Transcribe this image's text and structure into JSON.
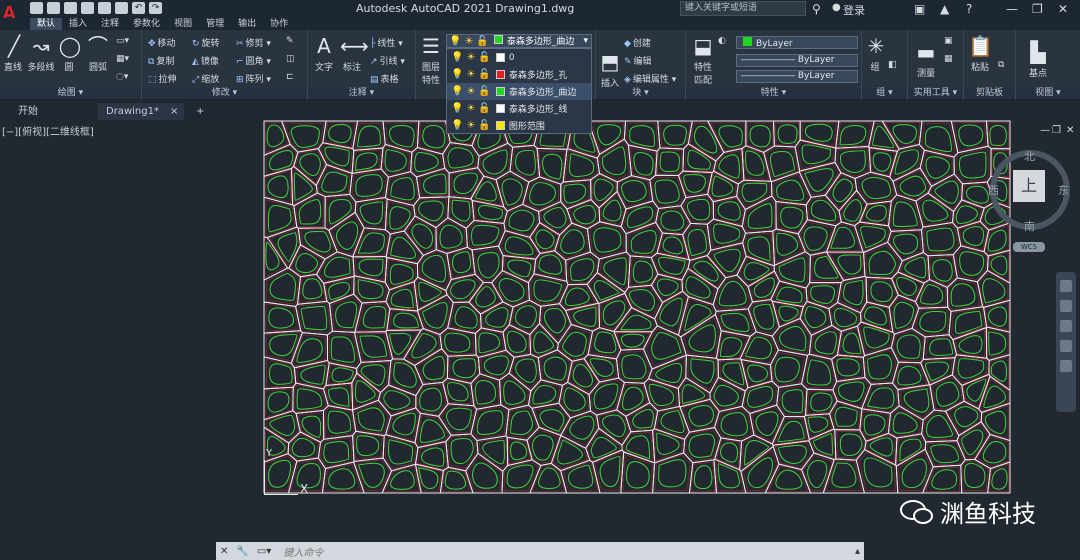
{
  "titlebar": {
    "title": "Autodesk AutoCAD 2021    Drawing1.dwg",
    "search_placeholder": "键入关键字或短语",
    "signin": "登录"
  },
  "ribbon_tabs": [
    "默认",
    "插入",
    "注释",
    "参数化",
    "视图",
    "管理",
    "输出",
    "协作"
  ],
  "ribbon": {
    "draw": {
      "label": "绘图 ▾",
      "line": "直线",
      "polyline": "多段线",
      "circle": "圆",
      "arc": "圆弧"
    },
    "modify": {
      "label": "修改 ▾",
      "move": "移动",
      "rotate": "旋转",
      "trim": "修剪 ▾",
      "copy": "复制",
      "mirror": "镜像",
      "fillet": "圆角 ▾",
      "stretch": "拉伸",
      "scale": "缩放",
      "array": "阵列 ▾"
    },
    "annotation": {
      "label": "注释 ▾",
      "text": "文字",
      "dimension": "标注",
      "linear": "线性 ▾",
      "leader": "引线 ▾",
      "table": "表格"
    },
    "layers": {
      "props": "图层\n特性",
      "current": "泰森多边形_曲边",
      "list": [
        {
          "name": "0",
          "color": "#ffffff"
        },
        {
          "name": "泰森多边形_孔",
          "color": "#e02020"
        },
        {
          "name": "泰森多边形_曲边",
          "color": "#22d622"
        },
        {
          "name": "泰森多边形_线",
          "color": "#ffffff"
        },
        {
          "name": "图形范围",
          "color": "#f5e800"
        }
      ],
      "selected_index": 2
    },
    "block": {
      "label": "块 ▾",
      "insert": "插入",
      "create": "创建",
      "edit": "编辑",
      "edit_attr": "编辑属性 ▾"
    },
    "properties": {
      "label": "特性 ▾",
      "match": "特性\n匹配",
      "color": "ByLayer",
      "linetype": "ByLayer",
      "lineweight": "ByLayer"
    },
    "groups": {
      "label": "组 ▾",
      "group": "组"
    },
    "utilities": {
      "label": "实用工具 ▾",
      "measure": "测量"
    },
    "clipboard": {
      "label": "剪贴板",
      "paste": "粘贴"
    },
    "view": {
      "label": "视图 ▾",
      "base": "基点"
    }
  },
  "file_tabs": {
    "start": "开始",
    "drawing": "Drawing1*",
    "close": "×",
    "add": "+"
  },
  "viewport": {
    "label": "[−][俯视][二维线框]",
    "compass": {
      "n": "北",
      "s": "南",
      "e": "东",
      "w": "西",
      "top": "上"
    },
    "wcs": "WCS",
    "ucs_x": "X",
    "ucs_y": "Y"
  },
  "command_line": {
    "placeholder": "键入命令"
  },
  "watermark": {
    "text": "渊鱼科技"
  }
}
